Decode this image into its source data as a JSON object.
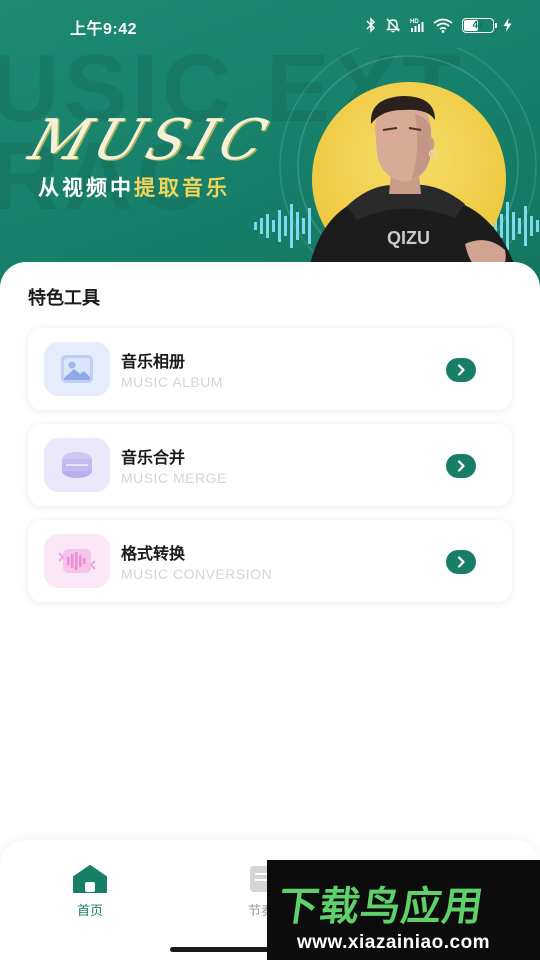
{
  "status_bar": {
    "time": "上午9:42",
    "battery_level": "47",
    "icons": [
      "bluetooth-icon",
      "mute-bell-icon",
      "hd-signal-icon",
      "wifi-icon",
      "battery-icon",
      "charging-icon"
    ]
  },
  "banner": {
    "background_text": "USIC EXT",
    "background_text_line2": "RAC",
    "logo_text": "MUSIC",
    "subtitle_prefix": "从视频中",
    "subtitle_highlight": "提取音乐",
    "colors": {
      "primary": "#177f68",
      "accent": "#f2d45c",
      "sun": "#efc940"
    }
  },
  "tools": {
    "section_title": "特色工具",
    "items": [
      {
        "title": "音乐相册",
        "subtitle": "MUSIC ALBUM",
        "icon": "photo-album-icon",
        "icon_bg": "#e6ecfb"
      },
      {
        "title": "音乐合并",
        "subtitle": "MUSIC MERGE",
        "icon": "merge-disc-icon",
        "icon_bg": "#ece8fb"
      },
      {
        "title": "格式转换",
        "subtitle": "MUSIC CONVERSION",
        "icon": "format-convert-icon",
        "icon_bg": "#fbe8f6"
      }
    ],
    "arrow_icon": "chevron-right-icon"
  },
  "bottom_nav": {
    "items": [
      {
        "label": "首页",
        "icon": "home-icon",
        "active": true
      },
      {
        "label": "节奏",
        "icon": "rhythm-icon",
        "active": false
      }
    ]
  },
  "watermark": {
    "logo": "下载鸟应用",
    "url": "www.xiazainiao.com"
  }
}
